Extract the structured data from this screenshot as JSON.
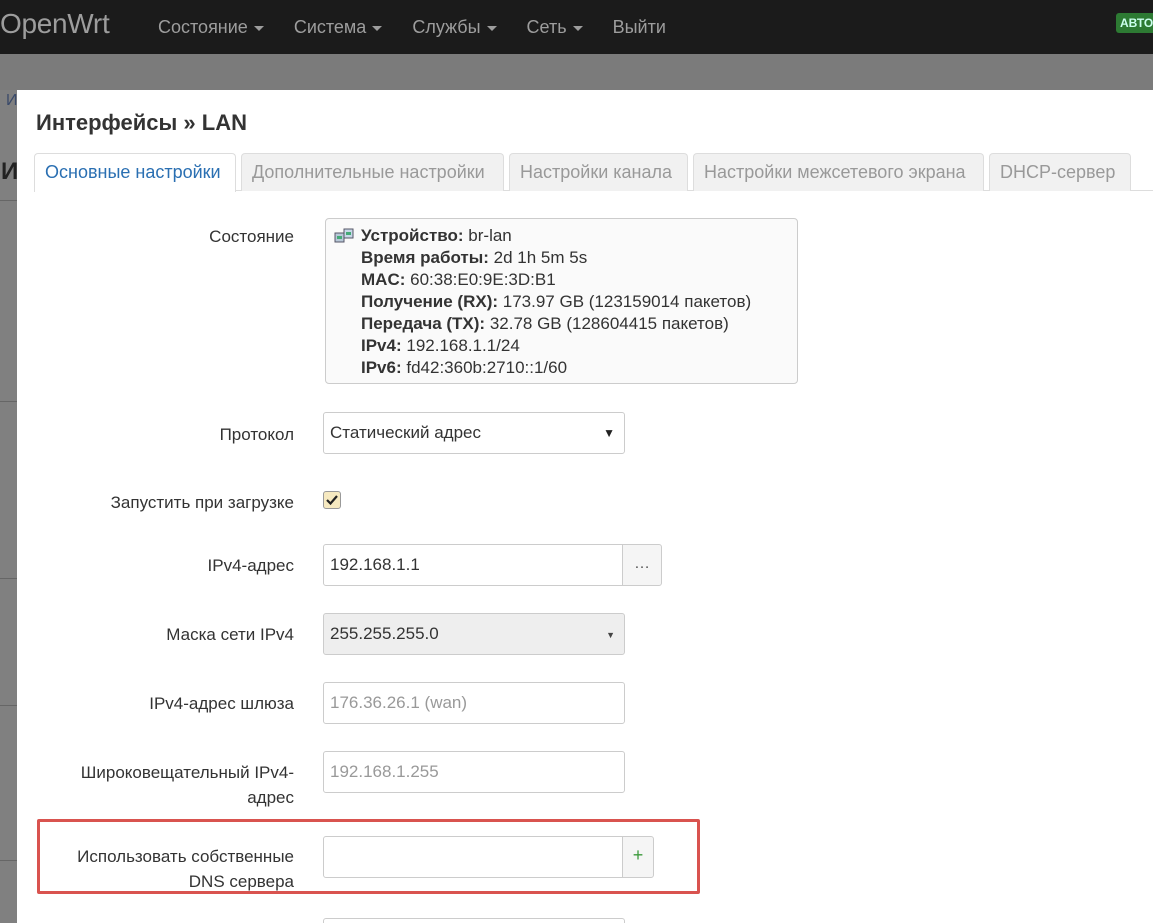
{
  "nav": {
    "brand": "OpenWrt",
    "menu": [
      {
        "label": "Состояние",
        "dropdown": true
      },
      {
        "label": "Система",
        "dropdown": true
      },
      {
        "label": "Службы",
        "dropdown": true
      },
      {
        "label": "Сеть",
        "dropdown": true
      },
      {
        "label": "Выйти",
        "dropdown": false
      }
    ],
    "badge": "АВТО"
  },
  "background": {
    "glyph_top": "И",
    "glyph_mid": "И"
  },
  "modal": {
    "title": "Интерфейсы » LAN",
    "tabs": [
      {
        "label": "Основные настройки",
        "active": true
      },
      {
        "label": "Дополнительные настройки",
        "active": false
      },
      {
        "label": "Настройки канала",
        "active": false
      },
      {
        "label": "Настройки межсетевого экрана",
        "active": false
      },
      {
        "label": "DHCP-сервер",
        "active": false
      }
    ],
    "status": {
      "label": "Состояние",
      "device_key": "Устройство:",
      "device_val": " br-lan",
      "uptime_key": "Время работы:",
      "uptime_val": " 2d 1h 5m 5s",
      "mac_key": "MAC:",
      "mac_val": " 60:38:E0:9E:3D:B1",
      "rx_key": "Получение (RX):",
      "rx_val": " 173.97 GB (123159014 пакетов)",
      "tx_key": "Передача (TX):",
      "tx_val": " 32.78 GB (128604415 пакетов)",
      "ipv4_key": "IPv4:",
      "ipv4_val": " 192.168.1.1/24",
      "ipv6_key": "IPv6:",
      "ipv6_val": " fd42:360b:2710::1/60"
    },
    "protocol": {
      "label": "Протокол",
      "value": "Статический адрес"
    },
    "autostart": {
      "label": "Запустить при загрузке",
      "checked": true
    },
    "ipv4_addr": {
      "label": "IPv4-адрес",
      "value": "192.168.1.1",
      "button": "…"
    },
    "ipv4_mask": {
      "label": "Маска сети IPv4",
      "value": "255.255.255.0"
    },
    "ipv4_gw": {
      "label": "IPv4-адрес шлюза",
      "placeholder": "176.36.26.1 (wan)"
    },
    "ipv4_bcast": {
      "label_line1": "Широковещательный IPv4-",
      "label_line2": "адрес",
      "placeholder": "192.168.1.255"
    },
    "dns": {
      "label_line1": "Использовать собственные",
      "label_line2": "DNS сервера",
      "value": "",
      "button": "+"
    }
  },
  "colors": {
    "active_tab": "#2a6fb2",
    "highlight": "#d9534f",
    "add_button": "#3c9a3c",
    "badge": "#2d7a33"
  }
}
